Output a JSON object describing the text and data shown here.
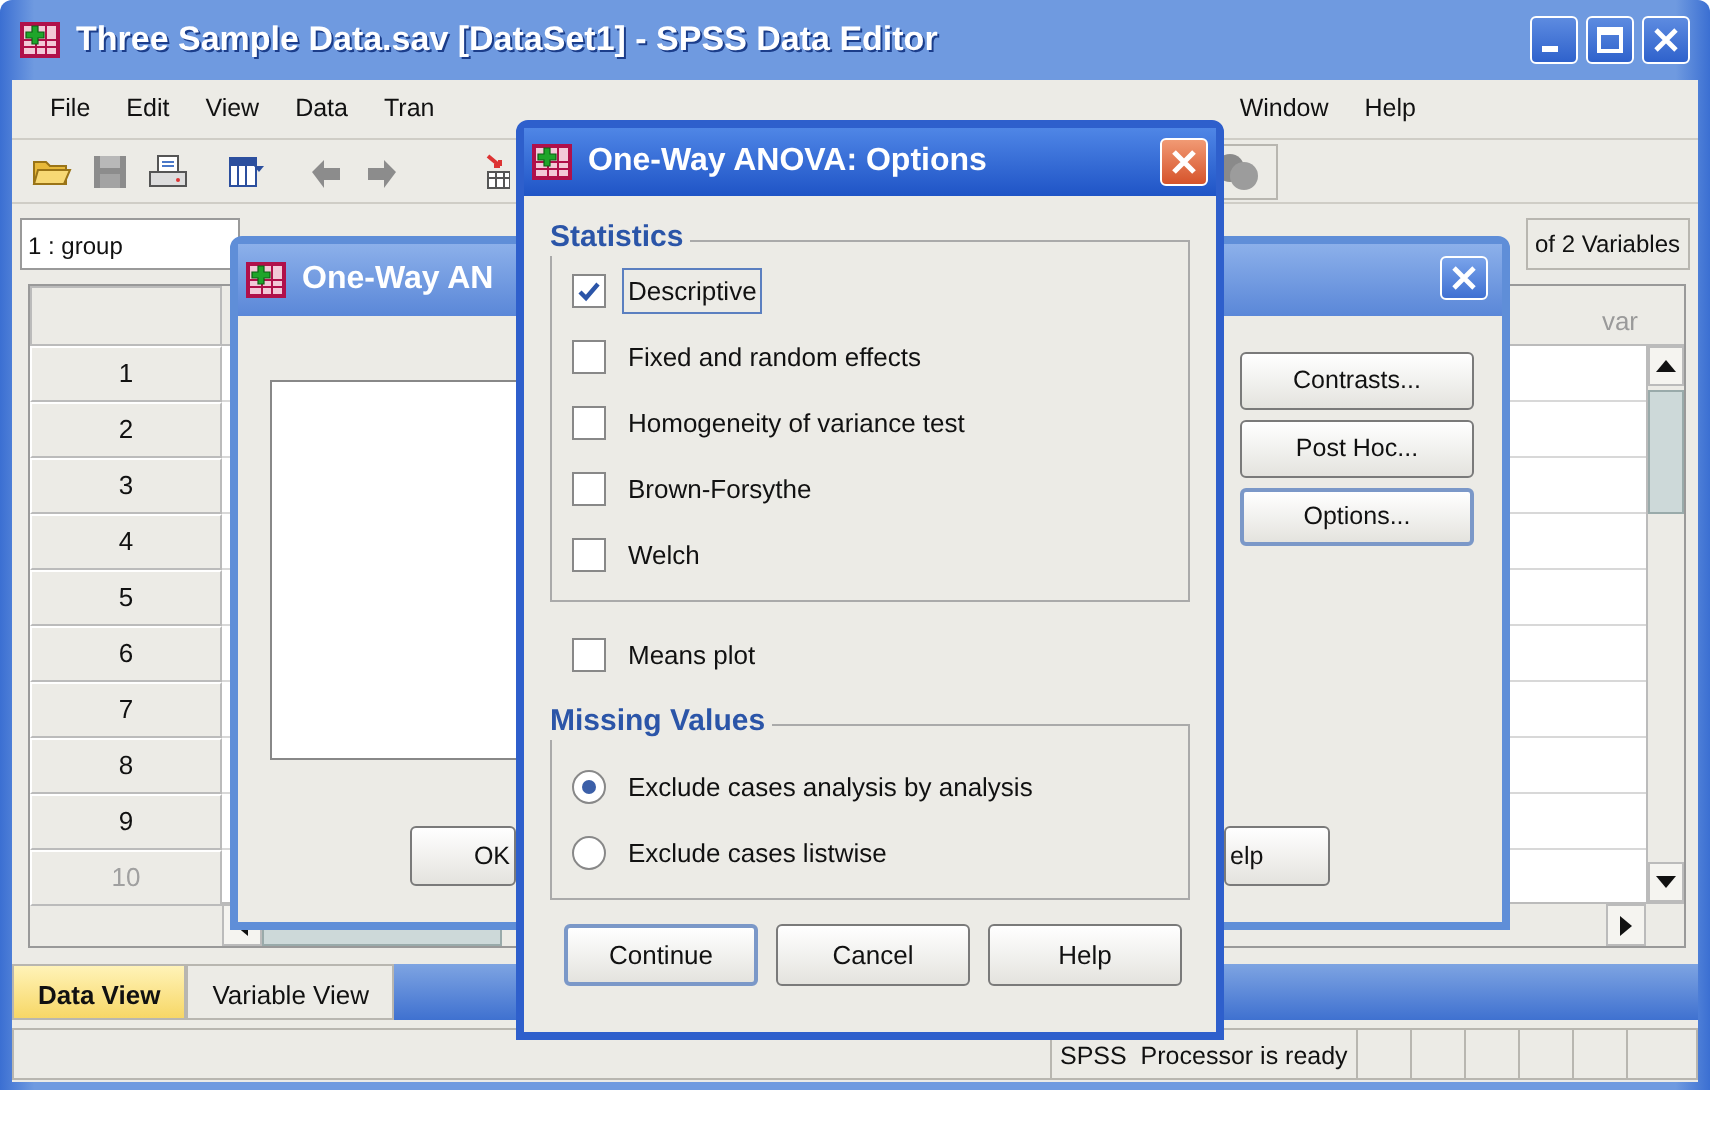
{
  "window": {
    "title": "Three Sample Data.sav [DataSet1] - SPSS Data Editor"
  },
  "menu_bar": {
    "left": [
      "File",
      "Edit",
      "View",
      "Data",
      "Tran"
    ],
    "right": [
      "Window",
      "Help"
    ]
  },
  "cell_reference": "1 : group",
  "variable_count": "of 2 Variables",
  "grid": {
    "column_header": "var",
    "rows": [
      {
        "label": "1",
        "has_data": true
      },
      {
        "label": "2",
        "has_data": true
      },
      {
        "label": "3",
        "has_data": true
      },
      {
        "label": "4",
        "has_data": true
      },
      {
        "label": "5",
        "has_data": true
      },
      {
        "label": "6",
        "has_data": true
      },
      {
        "label": "7",
        "has_data": true
      },
      {
        "label": "8",
        "has_data": true
      },
      {
        "label": "9",
        "has_data": true
      },
      {
        "label": "10",
        "has_data": false
      }
    ]
  },
  "tabs": [
    {
      "label": "Data View",
      "selected": true
    },
    {
      "label": "Variable View",
      "selected": false
    }
  ],
  "status_bar": {
    "message": "SPSS  Processor is ready"
  },
  "back_dialog": {
    "title": "One-Way AN",
    "side_buttons": [
      {
        "label": "Contrasts...",
        "focused": false
      },
      {
        "label": "Post Hoc...",
        "focused": false
      },
      {
        "label": "Options...",
        "focused": true
      }
    ],
    "bottom_buttons": [
      "OK",
      "elp"
    ]
  },
  "options_dialog": {
    "title": "One-Way ANOVA: Options",
    "statistics": {
      "legend": "Statistics",
      "options": [
        {
          "label": "Descriptive",
          "checked": true,
          "focused": true
        },
        {
          "label": "Fixed and random effects",
          "checked": false,
          "focused": false
        },
        {
          "label": "Homogeneity of variance test",
          "checked": false,
          "focused": false
        },
        {
          "label": "Brown-Forsythe",
          "checked": false,
          "focused": false
        },
        {
          "label": "Welch",
          "checked": false,
          "focused": false
        }
      ]
    },
    "means_plot": {
      "label": "Means plot",
      "checked": false
    },
    "missing_values": {
      "legend": "Missing Values",
      "options": [
        {
          "label": "Exclude cases analysis by analysis",
          "selected": true
        },
        {
          "label": "Exclude cases listwise",
          "selected": false
        }
      ]
    },
    "buttons": [
      {
        "label": "Continue",
        "default": true
      },
      {
        "label": "Cancel",
        "default": false
      },
      {
        "label": "Help",
        "default": false
      }
    ]
  }
}
